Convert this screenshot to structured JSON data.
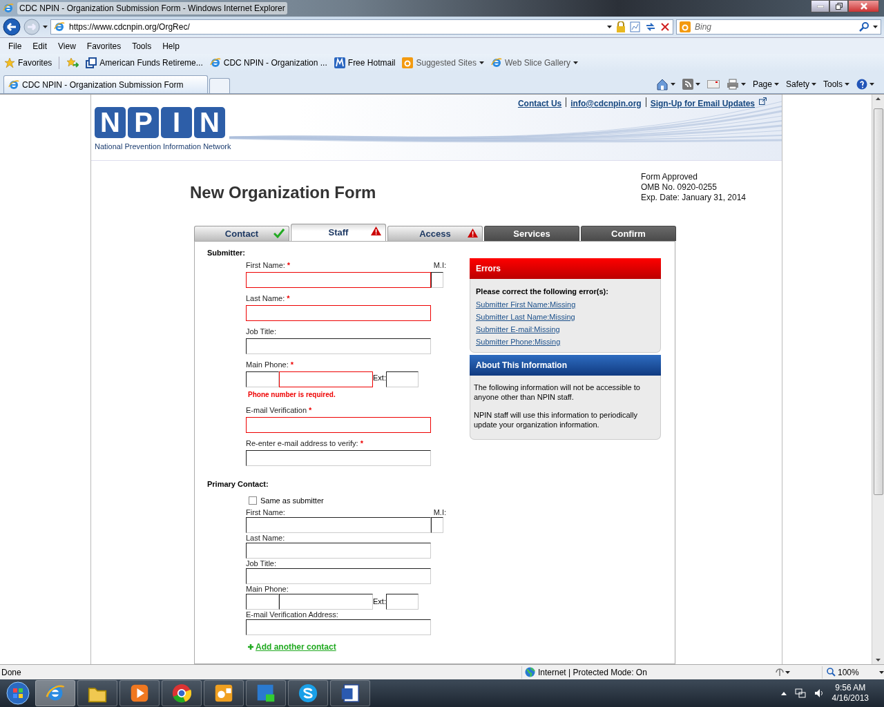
{
  "window": {
    "title": "CDC NPIN - Organization Submission Form - Windows Internet Explorer"
  },
  "address_bar": {
    "url": "https://www.cdcnpin.org/OrgRec/"
  },
  "search": {
    "placeholder": "Bing"
  },
  "menu": [
    "File",
    "Edit",
    "View",
    "Favorites",
    "Tools",
    "Help"
  ],
  "favorites_bar": {
    "label": "Favorites",
    "items": [
      {
        "label": "American Funds Retireme...",
        "kind": "windows",
        "dropdown": false
      },
      {
        "label": "CDC NPIN - Organization ...",
        "kind": "page",
        "dropdown": false
      },
      {
        "label": "Free Hotmail",
        "kind": "mail",
        "dropdown": false
      },
      {
        "label": "Suggested Sites",
        "kind": "sites",
        "dropdown": true
      },
      {
        "label": "Web Slice Gallery",
        "kind": "page",
        "dropdown": true
      }
    ]
  },
  "browser_tabs": [
    {
      "title": "CDC NPIN - Organization Submission Form",
      "selected": true
    }
  ],
  "command_bar": [
    "Page",
    "Safety",
    "Tools"
  ],
  "header_links": [
    "Contact Us",
    "info@cdcnpin.org",
    "Sign-Up for Email Updates"
  ],
  "logo": {
    "letters": [
      "N",
      "P",
      "I",
      "N"
    ],
    "subtitle": "National Prevention Information Network"
  },
  "title": "New Organization Form",
  "form_approval": [
    "Form Approved",
    "OMB No. 0920-0255",
    "Exp. Date: January 31, 2014"
  ],
  "form_tabs": [
    {
      "label": "Contact",
      "complete": true,
      "error": false,
      "selected": false,
      "enabled": true
    },
    {
      "label": "Staff",
      "complete": false,
      "error": true,
      "selected": true,
      "enabled": true
    },
    {
      "label": "Access",
      "complete": false,
      "error": true,
      "selected": false,
      "enabled": true
    },
    {
      "label": "Services",
      "complete": false,
      "error": false,
      "selected": false,
      "enabled": false
    },
    {
      "label": "Confirm",
      "complete": false,
      "error": false,
      "selected": false,
      "enabled": false
    }
  ],
  "sections": [
    {
      "heading": "Submitter:",
      "fields": [
        {
          "kind": "name",
          "label": "First Name:",
          "required_mark": "*",
          "invalid": true,
          "mi_label": "M.I:"
        },
        {
          "kind": "text",
          "label": "Last Name:",
          "required_mark": "*",
          "invalid": true
        },
        {
          "kind": "text",
          "label": "Job Title:",
          "invalid": false
        },
        {
          "kind": "phone",
          "label": "Main Phone:",
          "required_mark": "*",
          "invalid": true,
          "ext_label": "Ext:",
          "error": "Phone number is required."
        },
        {
          "kind": "text",
          "label": "E-mail Verification",
          "required_mark": "*",
          "invalid": true
        },
        {
          "kind": "text",
          "label": "Re-enter e-mail address to verify:",
          "required_mark": "*",
          "invalid": false
        }
      ]
    },
    {
      "heading": "Primary Contact:",
      "checkbox": {
        "label": "Same as submitter",
        "checked": false
      },
      "fields": [
        {
          "kind": "name",
          "label": "First Name:",
          "invalid": false,
          "mi_label": "M.I:"
        },
        {
          "kind": "text",
          "label": "Last Name:",
          "invalid": false
        },
        {
          "kind": "text",
          "label": "Job Title:",
          "invalid": false
        },
        {
          "kind": "phone",
          "label": "Main Phone:",
          "invalid": false,
          "ext_label": "Ext:"
        },
        {
          "kind": "text",
          "label": "E-mail Verification Address:",
          "invalid": false
        }
      ],
      "add_link": "Add another contact"
    }
  ],
  "errors_panel": {
    "title": "Errors",
    "intro": "Please correct the following error(s):",
    "links": [
      "Submitter First Name:Missing",
      "Submitter Last Name:Missing",
      "Submitter E-mail:Missing",
      "Submitter Phone:Missing"
    ]
  },
  "about_panel": {
    "title": "About This Information",
    "paragraphs": [
      "The following information will not be accessible to anyone other than NPIN staff.",
      "NPIN staff will use this information to periodically update your organization information."
    ]
  },
  "status_bar": {
    "text": "Done",
    "zone": "Internet | Protected Mode: On",
    "zoom": "100%"
  },
  "taskbar": {
    "apps": [
      {
        "kind": "browser",
        "active": true
      },
      {
        "kind": "folder",
        "active": false
      },
      {
        "kind": "media",
        "active": false
      },
      {
        "kind": "chrome",
        "active": false
      },
      {
        "kind": "outlook",
        "active": false
      },
      {
        "kind": "lync",
        "active": false
      },
      {
        "kind": "skype",
        "active": false
      },
      {
        "kind": "word",
        "active": false
      }
    ],
    "time": "9:56 AM",
    "date": "4/16/2013"
  }
}
